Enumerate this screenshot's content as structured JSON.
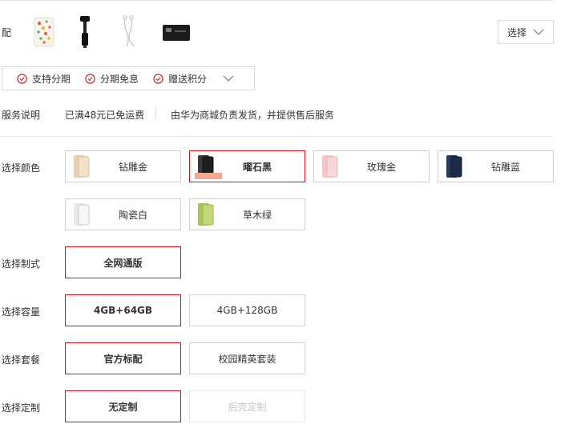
{
  "accessories": {
    "label": "配",
    "items": [
      {
        "icon": "phone-case-icon"
      },
      {
        "icon": "selfie-stick-icon"
      },
      {
        "icon": "earphones-icon"
      },
      {
        "icon": "card-icon"
      }
    ],
    "select_label": "选择"
  },
  "promo": {
    "items": [
      "支持分期",
      "分期免息",
      "赠送积分"
    ],
    "accent": "#ca151e"
  },
  "service": {
    "label": "服务说明",
    "shipping": "已满48元已免运费",
    "seller": "由华为商城负责发货，并提供售后服务"
  },
  "color": {
    "label": "选择颜色",
    "options": [
      {
        "name": "钻雕金",
        "selected": false,
        "swatch": "#e6d2b0"
      },
      {
        "name": "曜石黑",
        "selected": true,
        "swatch": "#2b2b2b"
      },
      {
        "name": "玫瑰金",
        "selected": false,
        "swatch": "#f3c7c7"
      },
      {
        "name": "钻雕蓝",
        "selected": false,
        "swatch": "#1c2a4a"
      },
      {
        "name": "陶瓷白",
        "selected": false,
        "swatch": "#f1f1f1"
      },
      {
        "name": "草木绿",
        "selected": false,
        "swatch": "#b7cf6a"
      }
    ]
  },
  "network": {
    "label": "选择制式",
    "options": [
      {
        "name": "全网通版",
        "selected": true
      }
    ]
  },
  "capacity": {
    "label": "选择容量",
    "options": [
      {
        "name": "4GB+64GB",
        "selected": true
      },
      {
        "name": "4GB+128GB",
        "selected": false
      }
    ]
  },
  "bundle": {
    "label": "选择套餐",
    "options": [
      {
        "name": "官方标配",
        "selected": true
      },
      {
        "name": "校园精英套装",
        "selected": false
      }
    ]
  },
  "custom": {
    "label": "选择定制",
    "options": [
      {
        "name": "无定制",
        "selected": true
      },
      {
        "name": "后壳定制",
        "selected": false,
        "disabled": true
      }
    ]
  }
}
